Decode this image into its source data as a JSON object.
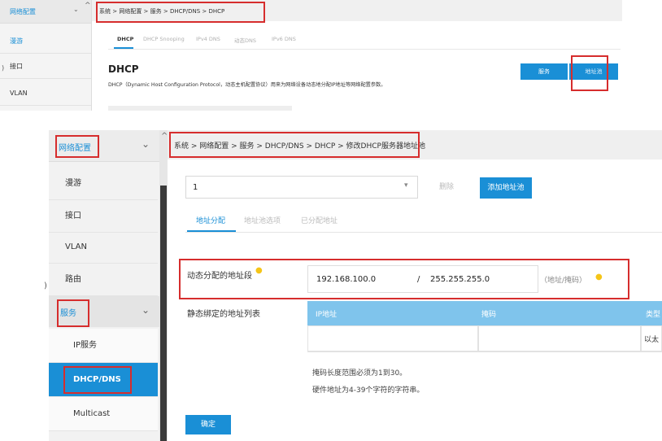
{
  "top": {
    "sidebar": {
      "header": "网络配置",
      "items": [
        "漫游",
        "接口",
        "VLAN"
      ]
    },
    "breadcrumb": "系统 > 网络配置 > 服务 > DHCP/DNS > DHCP",
    "tabs": [
      "DHCP",
      "DHCP Snooping",
      "IPv4 DNS",
      "动态DNS",
      "IPv6 DNS"
    ],
    "section_title": "DHCP",
    "description": "DHCP（Dynamic Host Configuration Protocol，动态主机配置协议）用来为网络设备动态地分配IP地址等网络配置参数。",
    "buttons": {
      "service": "服务",
      "address_pool": "地址池"
    }
  },
  "bottom": {
    "sidebar": {
      "header": "网络配置",
      "items": [
        "漫游",
        "接口",
        "VLAN",
        "路由"
      ],
      "service_group": "服务",
      "sub_items": [
        "IP服务",
        "DHCP/DNS",
        "Multicast"
      ]
    },
    "breadcrumb": "系统 > 网络配置 > 服务 > DHCP/DNS > DHCP > 修改DHCP服务器地址池",
    "pool_select": {
      "value": "1"
    },
    "buttons": {
      "delete": "删除",
      "add_pool": "添加地址池",
      "confirm": "确定"
    },
    "tabs": [
      "地址分配",
      "地址池选项",
      "已分配地址"
    ],
    "dynamic_range": {
      "label": "动态分配的地址段",
      "ip": "192.168.100.0",
      "separator": "/",
      "mask": "255.255.255.0",
      "hint": "（地址/掩码）"
    },
    "static_list": {
      "label": "静态绑定的地址列表",
      "headers": [
        "IP地址",
        "掩码",
        "类型"
      ],
      "row": [
        "",
        "",
        "以太"
      ]
    },
    "notes": [
      "掩码长度范围必须为1到30。",
      "硬件地址为4-39个字符的字符串。"
    ]
  },
  "colors": {
    "accent": "#1a8fd6",
    "highlight": "#d62d2d",
    "bulb": "#f5c518"
  },
  "icons": [
    "chevron-down-icon",
    "chevron-up-icon",
    "lightbulb-icon"
  ]
}
